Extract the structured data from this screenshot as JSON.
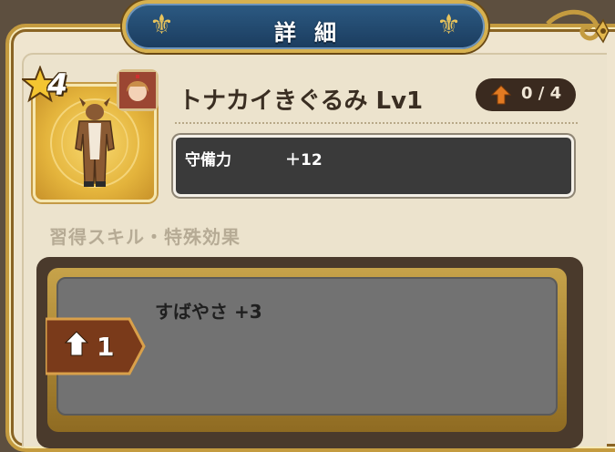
{
  "header": {
    "title": "詳細"
  },
  "item": {
    "rarity_stars": "4",
    "name": "トナカイきぐるみ Lv1",
    "level_progress": "0 / 4"
  },
  "stats": [
    {
      "label": "守備力",
      "value": "＋12"
    }
  ],
  "skills_section": {
    "title": "習得スキル・特殊効果",
    "entries": [
      {
        "unlock_level": "1",
        "text": "すばやさ +3"
      }
    ]
  },
  "colors": {
    "banner": "#1b3c5e",
    "gold_frame": "#c49b3f",
    "level_arrow": "#e27a22",
    "panel_bg": "#efe5cf"
  }
}
